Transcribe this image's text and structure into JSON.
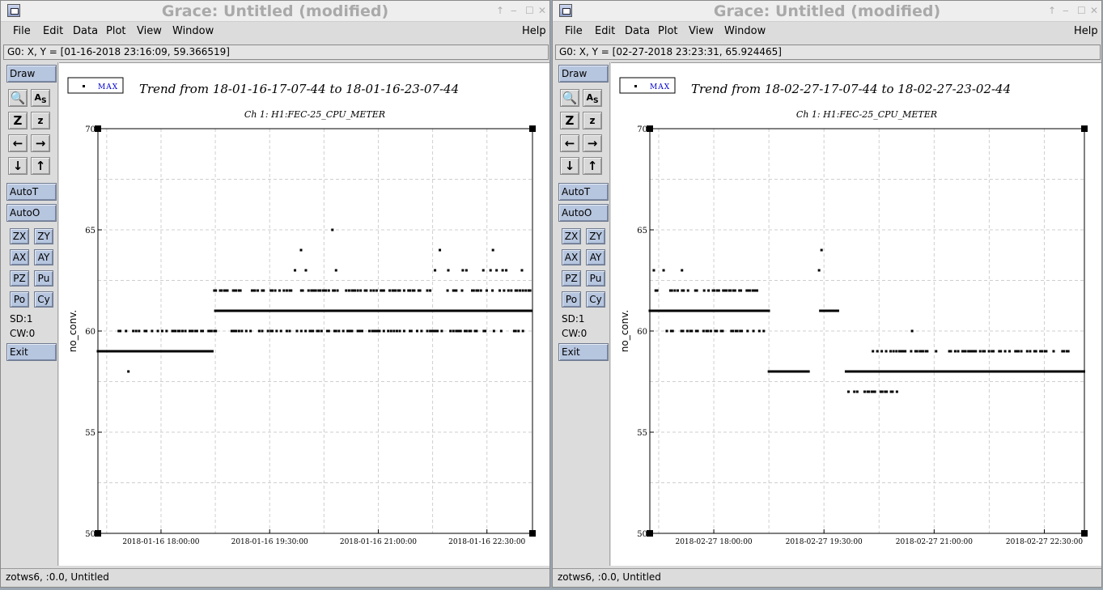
{
  "windows": [
    {
      "title": "Grace: Untitled (modified)",
      "menus": [
        "File",
        "Edit",
        "Data",
        "Plot",
        "View",
        "Window"
      ],
      "help": "Help",
      "locator": "G0: X, Y = [01-16-2018 23:16:09, 59.366519]",
      "toolbar": {
        "draw": "Draw",
        "autot": "AutoT",
        "autoo": "AutoO",
        "zx": "ZX",
        "zy": "ZY",
        "ax": "AX",
        "ay": "AY",
        "pz": "PZ",
        "pu": "Pu",
        "po": "Po",
        "cy": "Cy",
        "sd": "SD:1",
        "cw": "CW:0",
        "exit": "Exit"
      },
      "status": "zotws6, :0.0, Untitled",
      "chart": {
        "legend": "MAX",
        "title": "Trend from 18-01-16-17-07-44 to 18-01-16-23-07-44",
        "subtitle": "Ch 1: H1:FEC-25_CPU_METER",
        "ylabel": "no_conv.",
        "yticks": [
          "50",
          "55",
          "60",
          "65",
          "70"
        ],
        "xticks": [
          "2018-01-16 18:00:00",
          "2018-01-16 19:30:00",
          "2018-01-16 21:00:00",
          "2018-01-16 22:30:00"
        ],
        "ylim": [
          50,
          70
        ]
      }
    },
    {
      "title": "Grace: Untitled (modified)",
      "menus": [
        "File",
        "Edit",
        "Data",
        "Plot",
        "View",
        "Window"
      ],
      "help": "Help",
      "locator": "G0: X, Y = [02-27-2018 23:23:31, 65.924465]",
      "toolbar": {
        "draw": "Draw",
        "autot": "AutoT",
        "autoo": "AutoO",
        "zx": "ZX",
        "zy": "ZY",
        "ax": "AX",
        "ay": "AY",
        "pz": "PZ",
        "pu": "Pu",
        "po": "Po",
        "cy": "Cy",
        "sd": "SD:1",
        "cw": "CW:0",
        "exit": "Exit"
      },
      "status": "zotws6, :0.0, Untitled",
      "chart": {
        "legend": "MAX",
        "title": "Trend from 18-02-27-17-07-44 to 18-02-27-23-02-44",
        "subtitle": "Ch 1: H1:FEC-25_CPU_METER",
        "ylabel": "no_conv.",
        "yticks": [
          "50",
          "55",
          "60",
          "65",
          "70"
        ],
        "xticks": [
          "2018-02-27 18:00:00",
          "2018-02-27 19:30:00",
          "2018-02-27 21:00:00",
          "2018-02-27 22:30:00"
        ],
        "ylim": [
          50,
          70
        ]
      }
    }
  ],
  "chart_data": [
    {
      "type": "scatter",
      "title": "Trend from 18-01-16-17-07-44 to 18-01-16-23-07-44",
      "subtitle": "Ch 1: H1:FEC-25_CPU_METER",
      "xlabel": "",
      "ylabel": "no_conv.",
      "x_range": [
        "2018-01-16 17:07:44",
        "2018-01-16 23:07:44"
      ],
      "ylim": [
        50,
        70
      ],
      "legend": "top-left",
      "grid": true,
      "series": [
        {
          "name": "MAX",
          "runs": [
            {
              "y": 59,
              "from": "17:07:44",
              "to": "18:43:00"
            },
            {
              "y": 61,
              "from": "18:45:00",
              "to": "23:07:44"
            },
            {
              "y": 62,
              "from": "18:43:00",
              "to": "23:07:44",
              "sparse": true
            },
            {
              "y": 60,
              "from": "17:25:00",
              "to": "23:00:00",
              "sparse": true
            }
          ],
          "points": [
            {
              "x": "17:33:00",
              "y": 58
            },
            {
              "x": "19:51:00",
              "y": 63
            },
            {
              "x": "19:56:00",
              "y": 64
            },
            {
              "x": "20:00:00",
              "y": 63
            },
            {
              "x": "20:22:00",
              "y": 65
            },
            {
              "x": "20:25:00",
              "y": 63
            },
            {
              "x": "21:47:00",
              "y": 63
            },
            {
              "x": "21:51:00",
              "y": 64
            },
            {
              "x": "21:58:00",
              "y": 63
            },
            {
              "x": "22:10:00",
              "y": 63
            },
            {
              "x": "22:13:00",
              "y": 63
            },
            {
              "x": "22:27:00",
              "y": 63
            },
            {
              "x": "22:33:00",
              "y": 63
            },
            {
              "x": "22:35:00",
              "y": 64
            },
            {
              "x": "22:38:00",
              "y": 63
            },
            {
              "x": "22:43:00",
              "y": 63
            },
            {
              "x": "22:46:00",
              "y": 63
            },
            {
              "x": "22:59:00",
              "y": 63
            }
          ]
        }
      ]
    },
    {
      "type": "scatter",
      "title": "Trend from 18-02-27-17-07-44 to 18-02-27-23-02-44",
      "subtitle": "Ch 1: H1:FEC-25_CPU_METER",
      "xlabel": "",
      "ylabel": "no_conv.",
      "x_range": [
        "2018-02-27 17:07:44",
        "2018-02-27 23:02:44"
      ],
      "ylim": [
        50,
        70
      ],
      "legend": "top-left",
      "grid": true,
      "series": [
        {
          "name": "MAX",
          "runs": [
            {
              "y": 61,
              "from": "17:07:44",
              "to": "18:45:00"
            },
            {
              "y": 62,
              "from": "17:07:44",
              "to": "18:45:00",
              "sparse": true
            },
            {
              "y": 60,
              "from": "17:18:00",
              "to": "18:45:00",
              "sparse": true
            },
            {
              "y": 58,
              "from": "18:45:00",
              "to": "19:18:00"
            },
            {
              "y": 61,
              "from": "19:27:00",
              "to": "19:42:00"
            },
            {
              "y": 58,
              "from": "19:48:00",
              "to": "23:02:44"
            },
            {
              "y": 59,
              "from": "20:10:00",
              "to": "23:00:00",
              "sparse": true
            },
            {
              "y": 57,
              "from": "19:50:00",
              "to": "20:40:00",
              "sparse": true
            }
          ],
          "points": [
            {
              "x": "17:11:00",
              "y": 63
            },
            {
              "x": "17:19:00",
              "y": 63
            },
            {
              "x": "17:34:00",
              "y": 63
            },
            {
              "x": "19:26:00",
              "y": 63
            },
            {
              "x": "19:28:00",
              "y": 64
            },
            {
              "x": "20:42:00",
              "y": 60
            }
          ]
        }
      ]
    }
  ]
}
